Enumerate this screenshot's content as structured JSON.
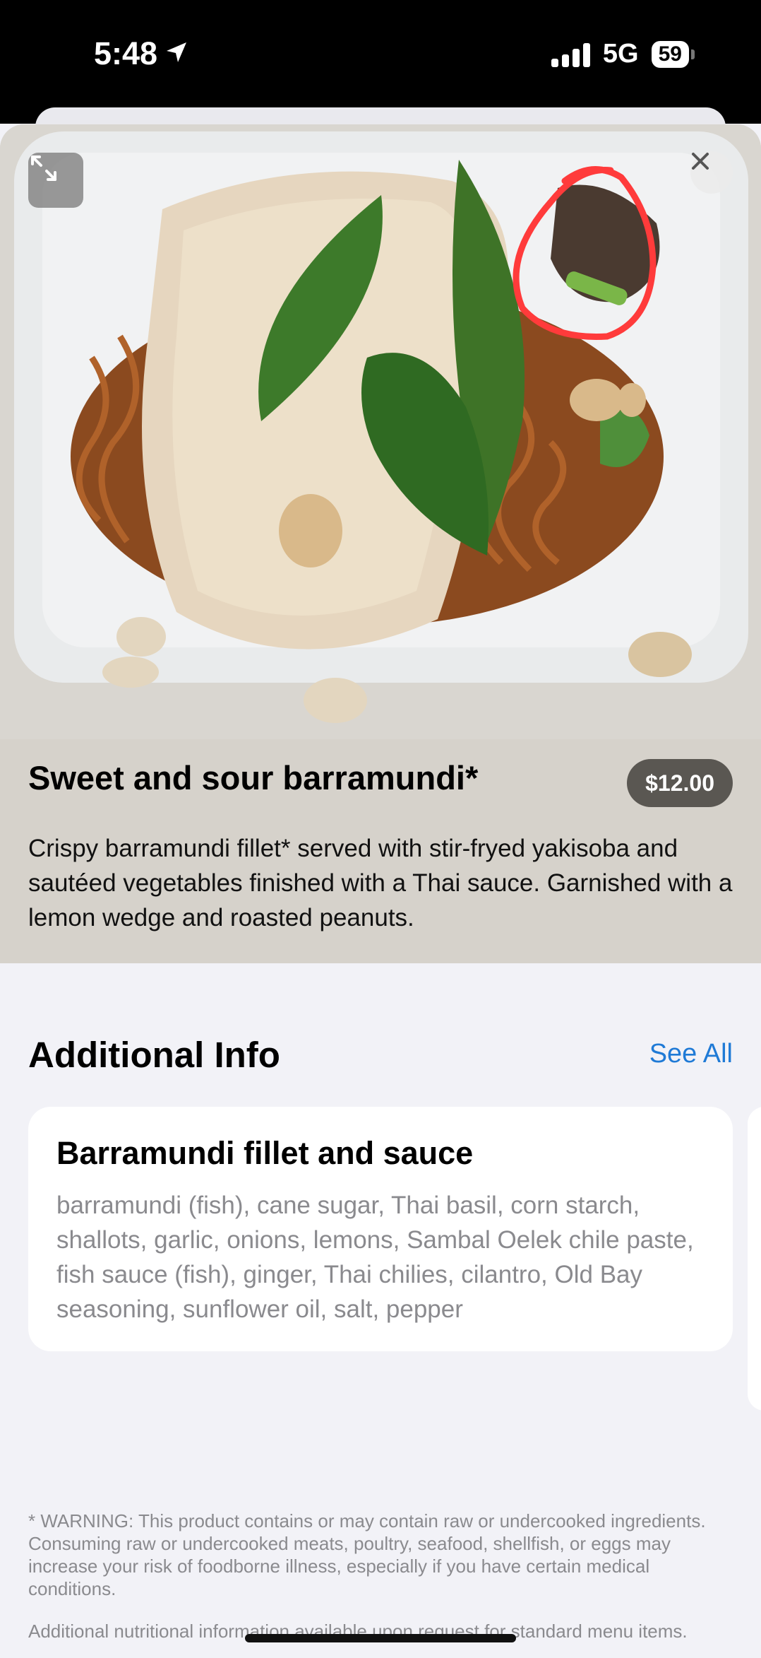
{
  "status_bar": {
    "time": "5:48",
    "network": "5G",
    "battery": "59"
  },
  "hero": {
    "expand_icon": "expand-arrows-icon",
    "close_icon": "close-x-icon"
  },
  "item": {
    "title": "Sweet and sour barramundi*",
    "price": "$12.00",
    "description": "Crispy barramundi fillet* served with stir-fryed yakisoba and sautéed vegetables finished with a Thai sauce. Garnished with a lemon wedge and roasted peanuts."
  },
  "additional_info": {
    "title": "Additional Info",
    "see_all": "See All",
    "cards": [
      {
        "title": "Barramundi fillet and sauce",
        "text": "barramundi (fish), cane sugar, Thai basil, corn starch, shallots, garlic, onions, lemons, Sambal Oelek chile paste, fish sauce (fish), ginger, Thai chilies, cilantro, Old Bay seasoning, sunflower oil, salt, pepper"
      }
    ]
  },
  "disclaimers": {
    "warning": "* WARNING: This product contains or may contain raw or undercooked ingredients.  Consuming raw or undercooked meats, poultry, seafood, shellfish, or eggs may increase your risk of foodborne illness, especially if you have certain medical conditions.",
    "nutrition": "Additional nutritional information available upon request for standard menu items."
  },
  "colors": {
    "accent": "#1f7ad6",
    "price_badge": "#5a5752",
    "background": "#f2f2f7",
    "annotation": "#ff3b3b"
  }
}
